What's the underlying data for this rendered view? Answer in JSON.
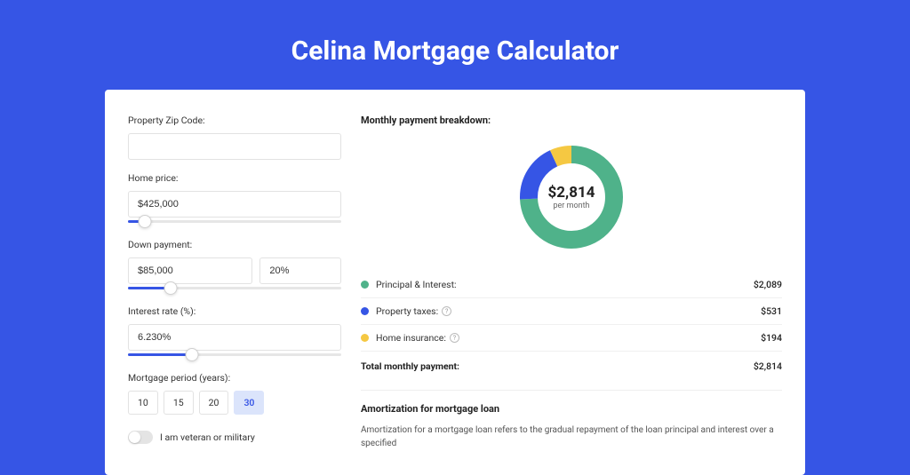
{
  "title": "Celina Mortgage Calculator",
  "form": {
    "zip_label": "Property Zip Code:",
    "zip_value": "",
    "home_price_label": "Home price:",
    "home_price_value": "$425,000",
    "home_price_slider_pct": 8,
    "down_label": "Down payment:",
    "down_value": "$85,000",
    "down_pct_value": "20%",
    "down_slider_pct": 20,
    "rate_label": "Interest rate (%):",
    "rate_value": "6.230%",
    "rate_slider_pct": 30,
    "period_label": "Mortgage period (years):",
    "periods": [
      "10",
      "15",
      "20",
      "30"
    ],
    "period_selected": "30",
    "veteran_label": "I am veteran or military"
  },
  "breakdown": {
    "heading": "Monthly payment breakdown:",
    "center_amount": "$2,814",
    "center_sub": "per month",
    "items": [
      {
        "label": "Principal & Interest:",
        "value": "$2,089",
        "color": "#4fb28a",
        "info": false
      },
      {
        "label": "Property taxes:",
        "value": "$531",
        "color": "#3655e5",
        "info": true
      },
      {
        "label": "Home insurance:",
        "value": "$194",
        "color": "#f5c842",
        "info": true
      }
    ],
    "total_label": "Total monthly payment:",
    "total_value": "$2,814"
  },
  "amort": {
    "heading": "Amortization for mortgage loan",
    "text": "Amortization for a mortgage loan refers to the gradual repayment of the loan principal and interest over a specified"
  },
  "chart_data": {
    "type": "pie",
    "title": "Monthly payment breakdown",
    "categories": [
      "Principal & Interest",
      "Property taxes",
      "Home insurance"
    ],
    "values": [
      2089,
      531,
      194
    ],
    "colors": [
      "#4fb28a",
      "#3655e5",
      "#f5c842"
    ],
    "total": 2814
  }
}
